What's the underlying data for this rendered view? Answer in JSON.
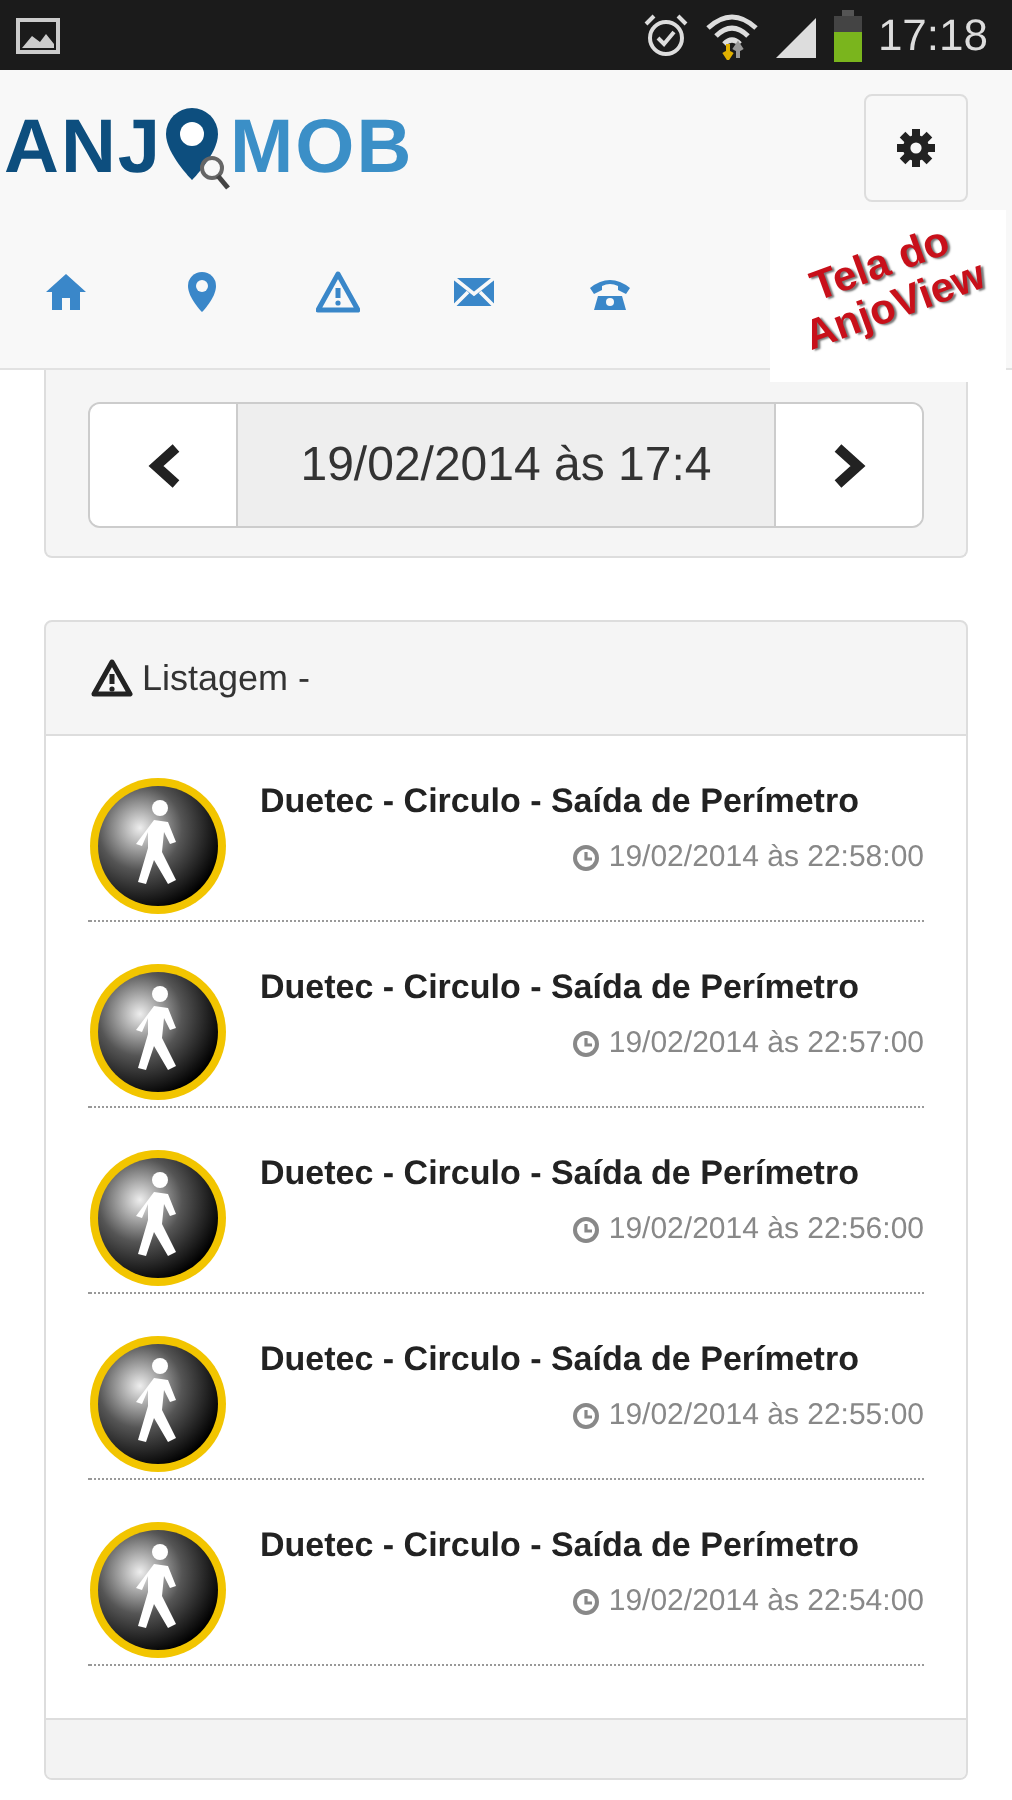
{
  "status_bar": {
    "time": "17:18"
  },
  "header": {
    "logo_left": "ANJ",
    "logo_right": "MOB",
    "stamp_lines": [
      "Tela do",
      "AnjoView"
    ]
  },
  "date_picker": {
    "value": "19/02/2014 às 17:4"
  },
  "listing": {
    "title": "Listagem -",
    "items": [
      {
        "title": "Duetec - Circulo - Saída de Perímetro",
        "time": "19/02/2014 às 22:58:00"
      },
      {
        "title": "Duetec - Circulo - Saída de Perímetro",
        "time": "19/02/2014 às 22:57:00"
      },
      {
        "title": "Duetec - Circulo - Saída de Perímetro",
        "time": "19/02/2014 às 22:56:00"
      },
      {
        "title": "Duetec - Circulo - Saída de Perímetro",
        "time": "19/02/2014 às 22:55:00"
      },
      {
        "title": "Duetec - Circulo - Saída de Perímetro",
        "time": "19/02/2014 às 22:54:00"
      }
    ]
  }
}
